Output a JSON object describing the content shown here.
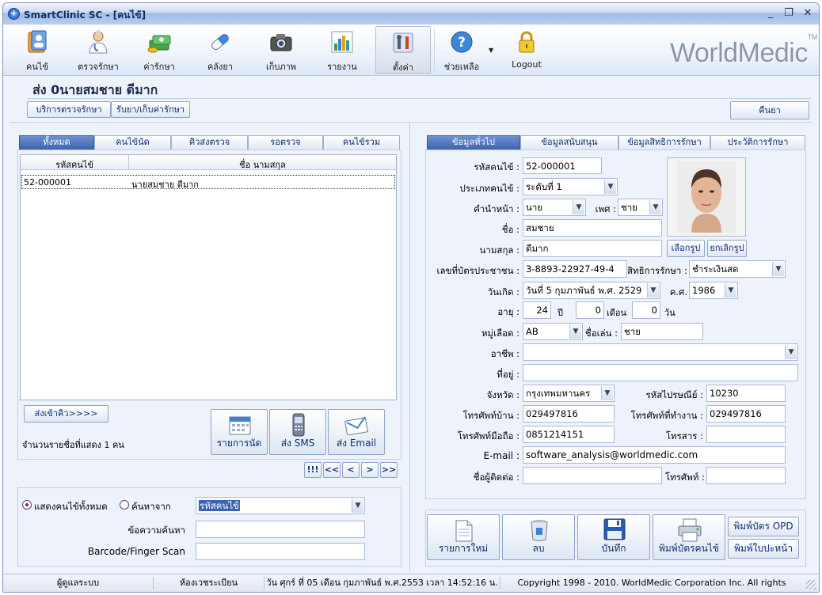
{
  "window": {
    "title": "SmartClinic SC - [คนไข้]",
    "controls": [
      "_",
      "❐",
      "✕"
    ]
  },
  "toolbar": {
    "items": [
      {
        "label": "คนไข้",
        "icon": "patient-folder-icon"
      },
      {
        "label": "ตรวจรักษา",
        "icon": "doctor-icon"
      },
      {
        "label": "ค่ารักษา",
        "icon": "money-icon"
      },
      {
        "label": "คลังยา",
        "icon": "pill-icon"
      },
      {
        "label": "เก็บภาพ",
        "icon": "camera-icon"
      },
      {
        "label": "รายงาน",
        "icon": "bar-chart-icon"
      },
      {
        "label": "ตั้งค่า",
        "icon": "tools-icon"
      },
      {
        "label": "ช่วยเหลือ",
        "icon": "help-icon"
      },
      {
        "label": "Logout",
        "icon": "lock-icon"
      }
    ],
    "brand": "WorldMedic",
    "brand_tm": "TM"
  },
  "header": {
    "patient_title": "ส่ง  0นายสมชาย ดีมาก",
    "btn_service": "บริการตรวจรักษา",
    "btn_receive": "รับยา/เก็บค่ารักษา",
    "btn_return": "คืนยา"
  },
  "left": {
    "tabs": [
      "ทั้งหมด",
      "คนไข้นัด",
      "คิวส่งตรวจ",
      "รอตรวจ",
      "คนไข้รวม"
    ],
    "columns": [
      "รหัสคนไข้",
      "ชื่อ นามสกุล"
    ],
    "rows": [
      {
        "id": "52-000001",
        "name": "นายสมชาย ดีมาก"
      }
    ],
    "btn_queue": "ส่งเข้าคิว>>>>",
    "count_text": "จำนวนรายชื่อที่แสดง 1 คน",
    "btn_appointment": "รายการนัด",
    "btn_sms": "ส่ง SMS",
    "btn_email": "ส่ง Email",
    "pager": [
      "!!!",
      "<<",
      "<",
      ">",
      ">>"
    ],
    "radio_all": "แสดงคนไข้ทั้งหมด",
    "radio_search": "ค้นหาจาก",
    "search_by": "รหัสคนไข้",
    "search_text_label": "ข้อความค้นหา",
    "barcode_label": "Barcode/Finger Scan",
    "search_text": "",
    "barcode": ""
  },
  "right": {
    "tabs": [
      "ข้อมูลทั่วไป",
      "ข้อมูลสนับสนุน",
      "ข้อมูลสิทธิการรักษา",
      "ประวัติการรักษา"
    ],
    "labels": {
      "hn": "รหัสคนไข้ :",
      "type": "ประเภทคนไข้ :",
      "prefix": "คำนำหน้า :",
      "sex": "เพศ :",
      "fname": "ชื่อ :",
      "lname": "นามสกุล :",
      "idcard": "เลขที่บัตรประชาชน :",
      "right": "สิทธิการรักษา :",
      "dob": "วันเกิด :",
      "ad": "ค.ศ.",
      "age": "อายุ :",
      "years": "ปี",
      "months": "เดือน",
      "days": "วัน",
      "blood": "หมู่เลือด :",
      "nick": "ชื่อเล่น :",
      "job": "อาชีพ :",
      "address": "ที่อยู่ :",
      "province": "จังหวัด :",
      "zip": "รหัสไปรษณีย์ :",
      "homephone": "โทรศัพท์บ้าน :",
      "workphone": "โทรศัพท์ที่ทำงาน :",
      "mobile": "โทรศัพท์มือถือ :",
      "fax": "โทรสาร :",
      "email": "E-mail :",
      "contact": "ชื่อผู้ติดต่อ :",
      "contactphone": "โทรศัพท์ :"
    },
    "values": {
      "hn": "52-000001",
      "type": "ระดับที่ 1",
      "prefix": "นาย",
      "sex": "ชาย",
      "fname": "สมชาย",
      "lname": "ดีมาก",
      "idcard": "3-8893-22927-49-4",
      "right": "ชำระเงินสด",
      "dob": "วันที่  5 กุมภาพันธ์ พ.ศ. 2529",
      "ad": "1986",
      "age_y": "24",
      "age_m": "0",
      "age_d": "0",
      "blood": "AB",
      "nick": "ชาย",
      "job": "",
      "address": "",
      "province": "กรุงเทพมหานคร",
      "zip": "10230",
      "homephone": "029497816",
      "workphone": "029497816",
      "mobile": "0851214151",
      "fax": "",
      "email": "software_analysis@worldmedic.com",
      "contact": "",
      "contactphone": ""
    },
    "btn_choose_photo": "เลือกรูป",
    "btn_cancel_photo": "ยกเลิกรูป",
    "actions": [
      "รายการใหม่",
      "ลบ",
      "บันทึก",
      "พิมพ์บัตรคนไข้"
    ],
    "btn_print_opd": "พิมพ์บัตร OPD",
    "btn_print_cover": "พิมพ์ใบปะหน้า"
  },
  "status": {
    "user": "ผู้ดูแลระบบ",
    "room": "ห้องเวชระเบียน",
    "datetime": "วัน ศุกร์ ที่ 05 เดือน กุมภาพันธ์ พ.ศ.2553 เวลา 14:52:16 น.",
    "copyright": "Copyright 1998 - 2010. WorldMedic Corporation Inc. All rights reserved."
  }
}
